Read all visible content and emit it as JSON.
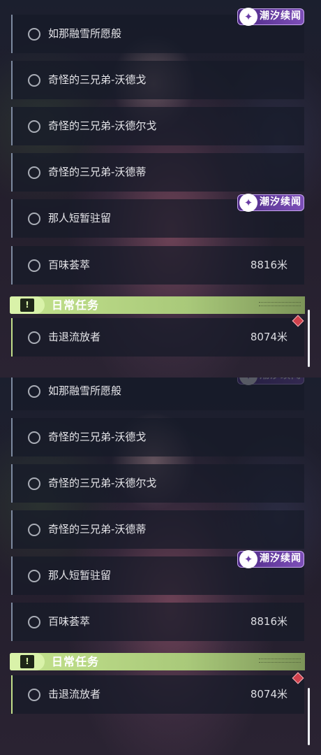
{
  "badge_label": "潮汐续闻",
  "badge_logo_glyph": "✦",
  "section": {
    "title": "日常任务",
    "icon_glyph": "!"
  },
  "panel_top": {
    "quests": [
      {
        "title": "如那融雪所愿般",
        "distance": ""
      },
      {
        "title": "奇怪的三兄弟-沃德戈",
        "distance": ""
      },
      {
        "title": "奇怪的三兄弟-沃德尔戈",
        "distance": ""
      },
      {
        "title": "奇怪的三兄弟-沃德蒂",
        "distance": ""
      },
      {
        "title": "那人短暂驻留",
        "distance": ""
      },
      {
        "title": "百味荟萃",
        "distance": "8816米"
      }
    ],
    "daily": [
      {
        "title": "击退流放者",
        "distance": "8074米"
      }
    ]
  },
  "panel_bottom": {
    "quests": [
      {
        "title": "如那融雪所愿般",
        "distance": ""
      },
      {
        "title": "奇怪的三兄弟-沃德戈",
        "distance": ""
      },
      {
        "title": "奇怪的三兄弟-沃德尔戈",
        "distance": ""
      },
      {
        "title": "奇怪的三兄弟-沃德蒂",
        "distance": ""
      },
      {
        "title": "那人短暂驻留",
        "distance": ""
      },
      {
        "title": "百味荟萃",
        "distance": "8816米"
      }
    ],
    "daily": [
      {
        "title": "击退流放者",
        "distance": "8074米"
      }
    ]
  },
  "colors": {
    "section_accent": "#c4e38d",
    "badge_purple": "#6a3da6",
    "marker_red": "#d0414c"
  },
  "icons": {
    "quest": "circle-icon",
    "badge": "tide-logo-icon",
    "section": "exclamation-icon",
    "marker": "diamond-marker-icon"
  }
}
